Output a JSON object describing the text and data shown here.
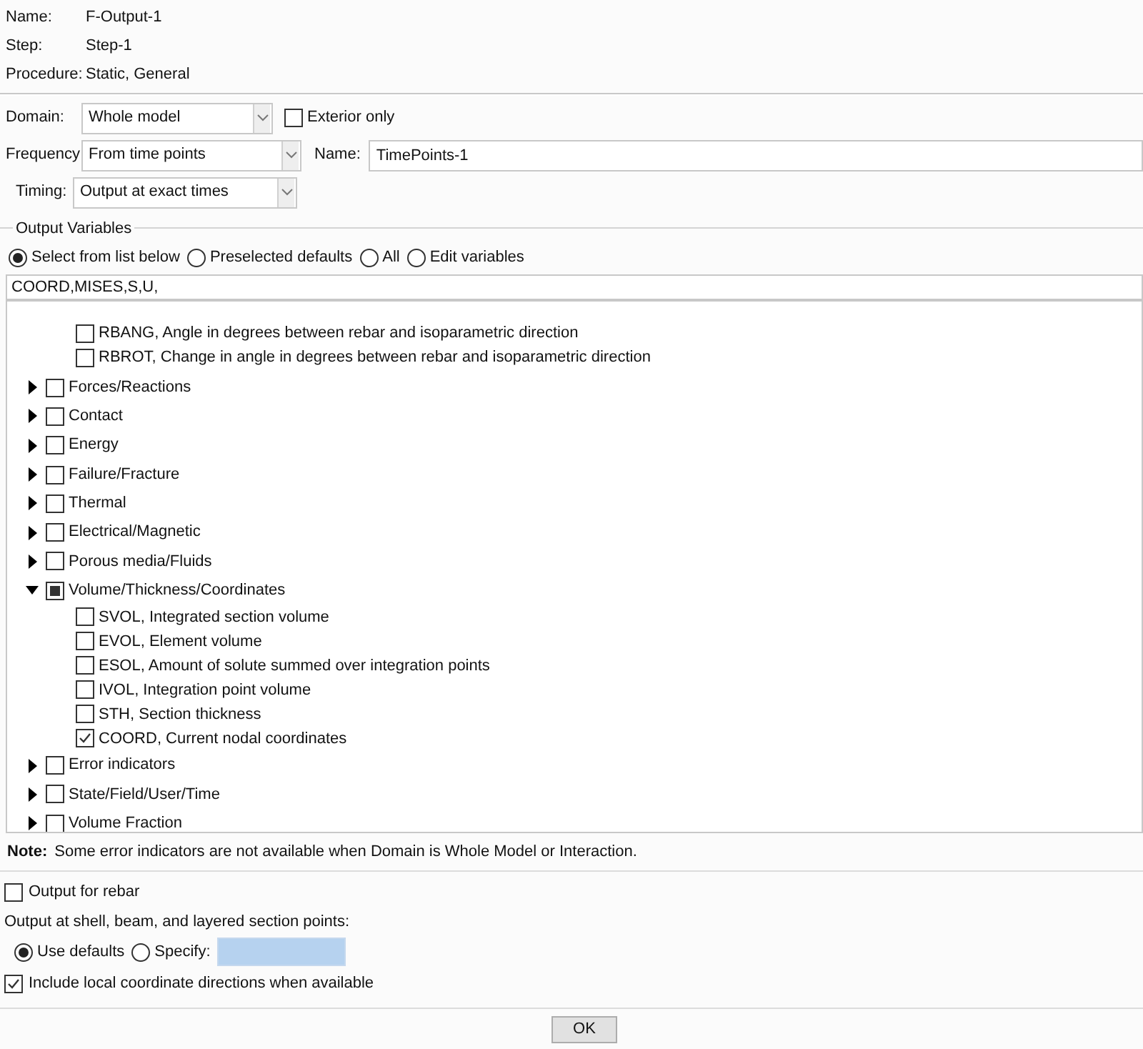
{
  "info": [
    {
      "label": "Name:",
      "value": "F-Output-1"
    },
    {
      "label": "Step:",
      "value": "Step-1"
    },
    {
      "label": "Procedure:",
      "value": "Static, General"
    }
  ],
  "domain": {
    "label": "Domain:",
    "value": "Whole model",
    "exterior_only": {
      "label": "Exterior only",
      "checked": false
    }
  },
  "frequency": {
    "label": "Frequency:",
    "value": "From time points",
    "name_label": "Name:",
    "name_value": "TimePoints-1"
  },
  "timing": {
    "label": "Timing:",
    "value": "Output at exact times"
  },
  "output_variables": {
    "title": "Output Variables",
    "options": [
      {
        "label": "Select from list below",
        "selected": true
      },
      {
        "label": "Preselected defaults",
        "selected": false
      },
      {
        "label": "All",
        "selected": false
      },
      {
        "label": "Edit variables",
        "selected": false
      }
    ],
    "value": "COORD,MISES,S,U,",
    "continued_children": [
      {
        "label": "RBANG, Angle in degrees between rebar and isoparametric direction",
        "checked": false
      },
      {
        "label": "RBROT, Change in angle in degrees between rebar and isoparametric direction",
        "checked": false
      }
    ],
    "tree": [
      {
        "label": "Forces/Reactions",
        "expanded": false,
        "checked": false,
        "partial": false
      },
      {
        "label": "Contact",
        "expanded": false,
        "checked": false,
        "partial": false
      },
      {
        "label": "Energy",
        "expanded": false,
        "checked": false,
        "partial": false
      },
      {
        "label": "Failure/Fracture",
        "expanded": false,
        "checked": false,
        "partial": false
      },
      {
        "label": "Thermal",
        "expanded": false,
        "checked": false,
        "partial": false
      },
      {
        "label": "Electrical/Magnetic",
        "expanded": false,
        "checked": false,
        "partial": false
      },
      {
        "label": "Porous media/Fluids",
        "expanded": false,
        "checked": false,
        "partial": false
      },
      {
        "label": "Volume/Thickness/Coordinates",
        "expanded": true,
        "checked": false,
        "partial": true,
        "children": [
          {
            "label": "SVOL, Integrated section volume",
            "checked": false
          },
          {
            "label": "EVOL, Element volume",
            "checked": false
          },
          {
            "label": "ESOL, Amount of solute summed over integration points",
            "checked": false
          },
          {
            "label": "IVOL, Integration point volume",
            "checked": false
          },
          {
            "label": "STH, Section thickness",
            "checked": false
          },
          {
            "label": "COORD, Current nodal coordinates",
            "checked": true
          }
        ]
      },
      {
        "label": "Error indicators",
        "expanded": false,
        "checked": false,
        "partial": false
      },
      {
        "label": "State/Field/User/Time",
        "expanded": false,
        "checked": false,
        "partial": false
      },
      {
        "label": "Volume Fraction",
        "expanded": false,
        "checked": false,
        "partial": false
      }
    ],
    "note_label": "Note:",
    "note": "Some error indicators are not available when Domain is Whole Model or Interaction."
  },
  "output_for_rebar": {
    "label": "Output for rebar",
    "checked": false
  },
  "section_points": {
    "label": "Output at shell, beam, and layered section points:",
    "options": [
      {
        "label": "Use defaults",
        "selected": true
      },
      {
        "label": "Specify:",
        "selected": false
      }
    ]
  },
  "local_coords": {
    "label": "Include local coordinate directions when available",
    "checked": true
  },
  "buttons": [
    "OK"
  ]
}
